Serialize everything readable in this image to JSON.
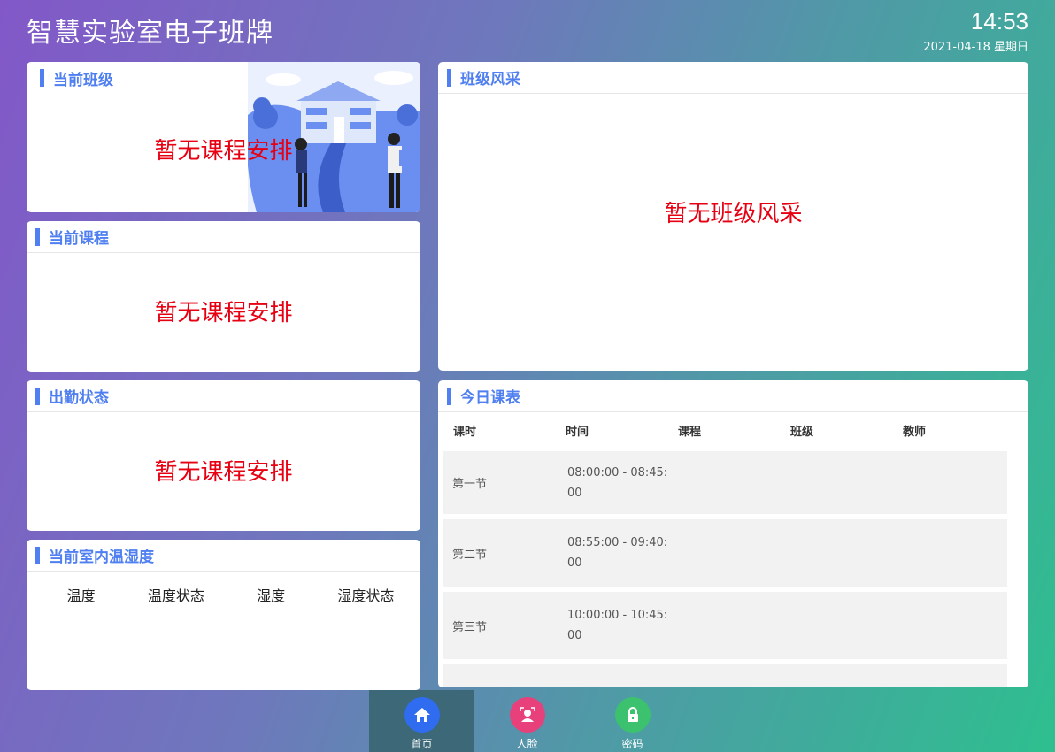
{
  "header": {
    "app_title": "智慧实验室电子班牌",
    "time": "14:53",
    "date": "2021-04-18 星期日"
  },
  "current_class": {
    "title": "当前班级",
    "empty": "暂无课程安排"
  },
  "current_course": {
    "title": "当前课程",
    "empty": "暂无课程安排"
  },
  "attendance": {
    "title": "出勤状态",
    "empty": "暂无课程安排"
  },
  "climate": {
    "title": "当前室内温湿度",
    "columns": [
      "温度",
      "温度状态",
      "湿度",
      "湿度状态"
    ]
  },
  "class_showcase": {
    "title": "班级风采",
    "empty": "暂无班级风采"
  },
  "schedule": {
    "title": "今日课表",
    "columns": [
      "课时",
      "时间",
      "课程",
      "班级",
      "教师"
    ],
    "rows": [
      {
        "period": "第一节",
        "time": "08:00:00 - 08:45:00"
      },
      {
        "period": "第二节",
        "time": "08:55:00 - 09:40:00"
      },
      {
        "period": "第三节",
        "time": "10:00:00 - 10:45:00"
      }
    ]
  },
  "nav": {
    "items": [
      {
        "label": "首页",
        "icon": "home-icon",
        "color": "#2f6cf0"
      },
      {
        "label": "人脸",
        "icon": "face-icon",
        "color": "#e8407a"
      },
      {
        "label": "密码",
        "icon": "lock-icon",
        "color": "#3cc26e"
      }
    ]
  }
}
